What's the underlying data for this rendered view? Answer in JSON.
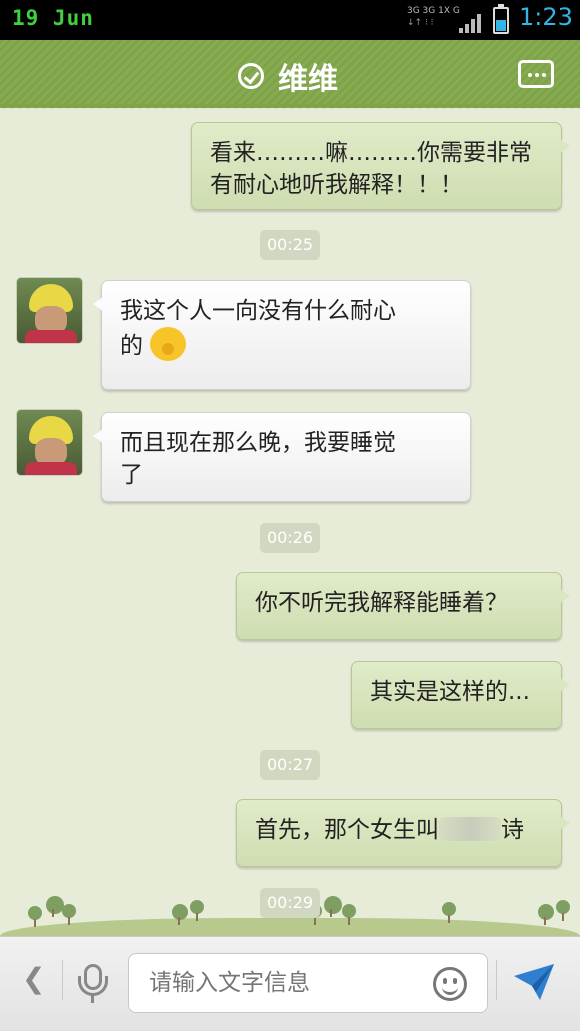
{
  "status_bar": {
    "date": "19 Jun",
    "time": "1:23",
    "net_1": "3G 3G 1X G"
  },
  "header": {
    "title": "维维"
  },
  "messages": [
    {
      "side": "out",
      "text_lines": [
        "看来………嘛………你需要非常",
        "有耐心地听我解释！！！"
      ]
    },
    {
      "time": "00:25"
    },
    {
      "side": "in",
      "text_lines": [
        "我这个人一向没有什么耐心",
        "的"
      ],
      "emoji": "grin-emoji"
    },
    {
      "side": "in",
      "text_lines": [
        "而且现在那么晚，我要睡觉",
        "了"
      ]
    },
    {
      "time": "00:26"
    },
    {
      "side": "out",
      "text_lines": [
        "你不听完我解释能睡着？"
      ]
    },
    {
      "side": "out",
      "text_lines": [
        "其实是这样的..."
      ]
    },
    {
      "time": "00:27"
    },
    {
      "side": "out",
      "text_before_blur": "首先，那个女生叫",
      "text_after_blur": "诗"
    },
    {
      "time": "00:29"
    }
  ],
  "input": {
    "placeholder": "请输入文字信息"
  },
  "colors": {
    "header": "#7ea348",
    "background": "#e7ecd9",
    "accent": "#33b5e5",
    "send": "#2f7fd0"
  }
}
